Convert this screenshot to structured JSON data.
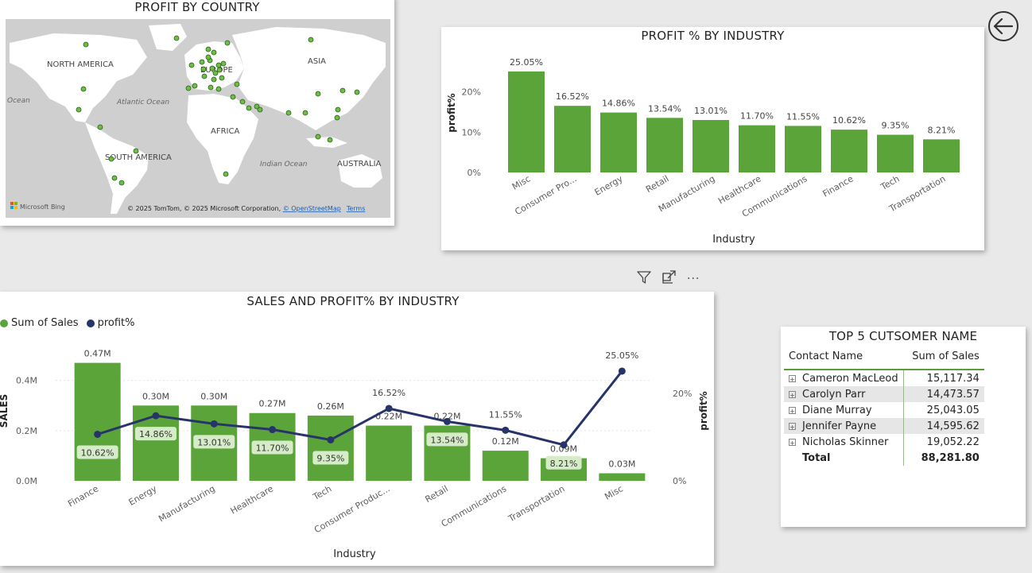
{
  "colors": {
    "bar_green": "#5ba43a",
    "line_navy": "#27346a",
    "map_land": "#ffffff",
    "map_water": "#cfcfcf",
    "map_dot": "#6cbe45"
  },
  "map": {
    "title": "PROFIT BY COUNTRY",
    "labels": {
      "north_america": "NORTH AMERICA",
      "europe": "EUROPE",
      "asia": "ASIA",
      "africa": "AFRICA",
      "south_america": "SOUTH AMERICA",
      "australia": "AUSTRALIA",
      "atlantic": "Atlantic Ocean",
      "indian": "Indian Ocean",
      "ocean_left": "Ocean"
    },
    "bing_label": "Microsoft Bing",
    "copyright": "© 2025 TomTom, © 2025 Microsoft Corporation, ",
    "osm_link": "© OpenStreetMap",
    "terms_link": "Terms"
  },
  "profit_chart": {
    "title": "PROFIT % BY INDUSTRY",
    "chart_data": {
      "type": "bar",
      "title": "PROFIT % BY INDUSTRY",
      "xlabel": "Industry",
      "ylabel": "profit%",
      "categories": [
        "Misc",
        "Consumer Pro...",
        "Energy",
        "Retail",
        "Manufacturing",
        "Healthcare",
        "Communications",
        "Finance",
        "Tech",
        "Transportation"
      ],
      "values": [
        25.05,
        16.52,
        14.86,
        13.54,
        13.01,
        11.7,
        11.55,
        10.62,
        9.35,
        8.21
      ],
      "data_labels": [
        "25.05%",
        "16.52%",
        "14.86%",
        "13.54%",
        "13.01%",
        "11.70%",
        "11.55%",
        "10.62%",
        "9.35%",
        "8.21%"
      ],
      "yticks": [
        "0%",
        "10%",
        "20%"
      ],
      "ylim": [
        0,
        27
      ]
    }
  },
  "combo_chart": {
    "title": "SALES AND PROFIT% BY INDUSTRY",
    "legend": {
      "sales": "Sum of Sales",
      "profit": "profit%"
    },
    "chart_data": {
      "type": "bar",
      "title": "SALES AND PROFIT% BY INDUSTRY",
      "xlabel": "Industry",
      "ylabel": "SALES",
      "y2label": "profit%",
      "categories": [
        "Finance",
        "Energy",
        "Manufacturing",
        "Healthcare",
        "Tech",
        "Consumer Produc...",
        "Retail",
        "Communications",
        "Transportation",
        "Misc"
      ],
      "series": [
        {
          "name": "Sum of Sales",
          "type": "bar",
          "values": [
            0.47,
            0.3,
            0.3,
            0.27,
            0.26,
            0.22,
            0.22,
            0.12,
            0.09,
            0.03
          ],
          "labels": [
            "0.47M",
            "0.30M",
            "0.30M",
            "0.27M",
            "0.26M",
            "0.22M",
            "0.22M",
            "0.12M",
            "0.09M",
            "0.03M"
          ]
        },
        {
          "name": "profit%",
          "type": "line",
          "values": [
            10.62,
            14.86,
            13.01,
            11.7,
            9.35,
            16.52,
            13.54,
            11.55,
            8.21,
            25.05
          ],
          "labels": [
            "10.62%",
            "14.86%",
            "13.01%",
            "11.70%",
            "9.35%",
            "16.52%",
            "13.54%",
            "11.55%",
            "8.21%",
            "25.05%"
          ]
        }
      ],
      "yticks": [
        "0.0M",
        "0.2M",
        "0.4M"
      ],
      "y2ticks": [
        "0%",
        "20%"
      ],
      "ylim": [
        0,
        0.5
      ],
      "y2lim": [
        0,
        26.5
      ]
    }
  },
  "top5": {
    "title": "TOP 5 CUTSOMER NAME",
    "columns": [
      "Contact Name",
      "Sum of Sales"
    ],
    "rows": [
      [
        "Cameron MacLeod",
        "15,117.34"
      ],
      [
        "Carolyn Parr",
        "14,473.57"
      ],
      [
        "Diane Murray",
        "25,043.05"
      ],
      [
        "Jennifer Payne",
        "14,595.62"
      ],
      [
        "Nicholas Skinner",
        "19,052.22"
      ]
    ],
    "total": [
      "Total",
      "88,281.80"
    ]
  },
  "toolbar": {
    "filter_icon": "filter-icon",
    "focus_icon": "focus-mode-icon",
    "more_icon": "more-options-icon",
    "more_label": "···"
  }
}
